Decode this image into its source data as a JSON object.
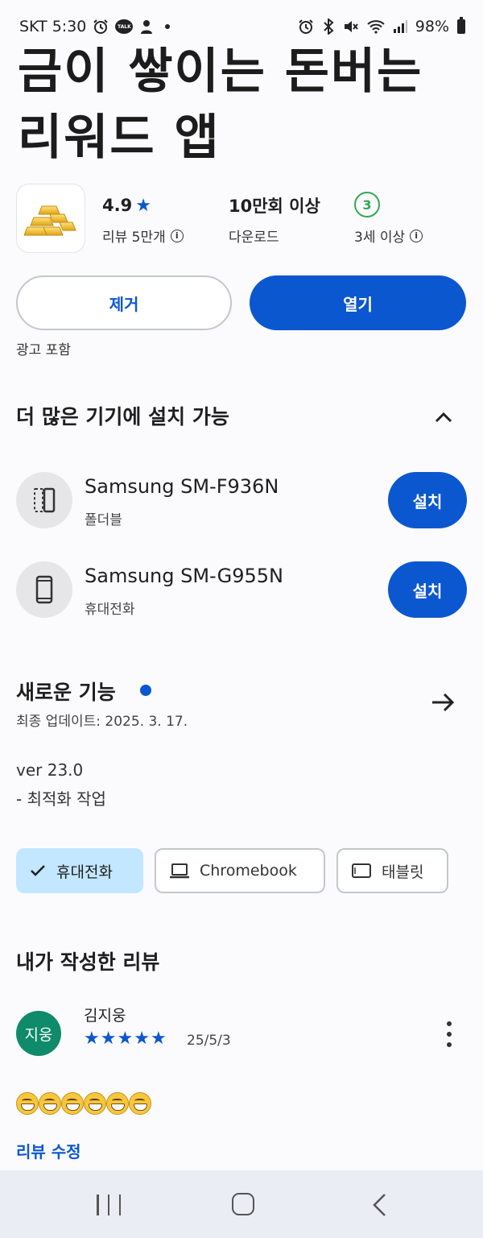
{
  "status_bar": {
    "carrier_time": "SKT 5:30",
    "left_icons": [
      "alarm-icon",
      "kakaotalk-icon",
      "app-icon",
      "dot"
    ],
    "kakao_label": "TALK",
    "right_icons": [
      "alarm-icon",
      "bluetooth-icon",
      "mute-icon",
      "wifi-icon",
      "signal-icon"
    ],
    "battery": "98%"
  },
  "app": {
    "title_line1": "금이 쌓이는 돈버는",
    "title_line2": "리워드 앱",
    "rating": "4.9",
    "rating_star": "★",
    "reviews": "리뷰 5만개",
    "downloads": "10만회 이상",
    "downloads_label": "다운로드",
    "age_rating": "3",
    "age_label": "3세 이상",
    "icon_name": "gold-bars-icon"
  },
  "actions": {
    "uninstall": "제거",
    "open": "열기",
    "ads_notice": "광고 포함"
  },
  "devices_section": {
    "title": "더 많은 기기에 설치 가능",
    "devices": [
      {
        "name": "Samsung SM-F936N",
        "type": "폴더블",
        "button": "설치",
        "icon": "foldable-icon"
      },
      {
        "name": "Samsung SM-G955N",
        "type": "휴대전화",
        "button": "설치",
        "icon": "phone-icon"
      }
    ]
  },
  "whats_new": {
    "title": "새로운 기능",
    "updated": "최종 업데이트: 2025. 3. 17.",
    "note_line1": "ver 23.0",
    "note_line2": "- 최적화 작업"
  },
  "chips": [
    {
      "label": "휴대전화",
      "selected": true,
      "icon": "check-icon"
    },
    {
      "label": "Chromebook",
      "selected": false,
      "icon": "laptop-icon"
    },
    {
      "label": "태블릿",
      "selected": false,
      "icon": "tablet-icon"
    }
  ],
  "my_review": {
    "title": "내가 작성한 리뷰",
    "avatar_text": "지웅",
    "reviewer": "김지웅",
    "stars": 5,
    "star_glyph": "★",
    "date": "25/5/3",
    "emoji_count": 6,
    "edit_label": "리뷰 수정"
  },
  "colors": {
    "accent": "#0b57d0",
    "chip_selected": "#c2e7ff",
    "avatar": "#0f8a6a",
    "age_badge": "#34a853"
  }
}
